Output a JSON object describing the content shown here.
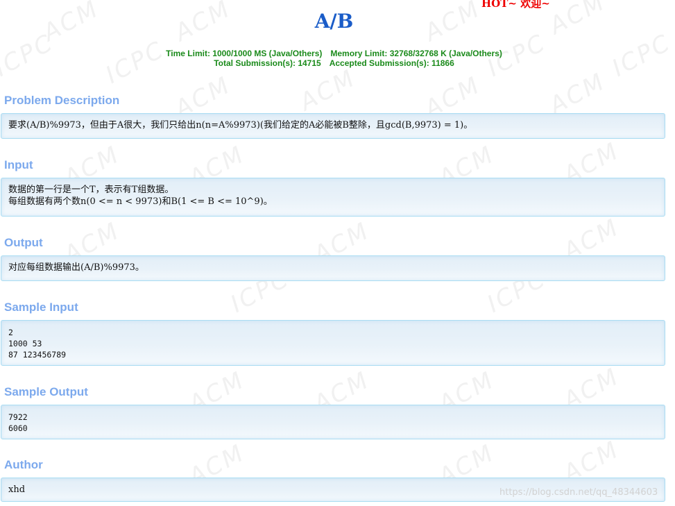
{
  "header": {
    "title": "A/B",
    "hot_banner": "HOT~ 欢迎~",
    "time_limit": "Time Limit: 1000/1000 MS (Java/Others)",
    "memory_limit": "Memory Limit: 32768/32768 K (Java/Others)",
    "total_submissions": "Total Submission(s): 14715",
    "accepted_submissions": "Accepted Submission(s): 11866"
  },
  "sections": {
    "description": {
      "title": "Problem Description",
      "lines": [
        "要求(A/B)%9973，但由于A很大，我们只给出n(n=A%9973)(我们给定的A必能被B整除，且gcd(B,9973) = 1)。"
      ]
    },
    "input": {
      "title": "Input",
      "lines": [
        "数据的第一行是一个T，表示有T组数据。",
        "每组数据有两个数n(0 <= n < 9973)和B(1 <= B <= 10^9)。"
      ]
    },
    "output": {
      "title": "Output",
      "lines": [
        "对应每组数据输出(A/B)%9973。"
      ]
    },
    "sample_input": {
      "title": "Sample Input",
      "lines": [
        "2",
        "1000 53",
        "87 123456789"
      ]
    },
    "sample_output": {
      "title": "Sample Output",
      "lines": [
        "7922",
        "6060"
      ]
    },
    "author": {
      "title": "Author",
      "lines": [
        "xhd"
      ]
    }
  },
  "watermark": {
    "acm_text": "ACM",
    "icpc_text": "ICPC",
    "csdn_url": "https://blog.csdn.net/qq_48344603"
  },
  "colors": {
    "title": "#1a5cc8",
    "section_title": "#7ca9ed",
    "limits_text": "#1a8a1a",
    "hot_banner": "#ee0000",
    "panel_border": "#a9dcf2",
    "panel_bg": "#e6f0f8"
  }
}
